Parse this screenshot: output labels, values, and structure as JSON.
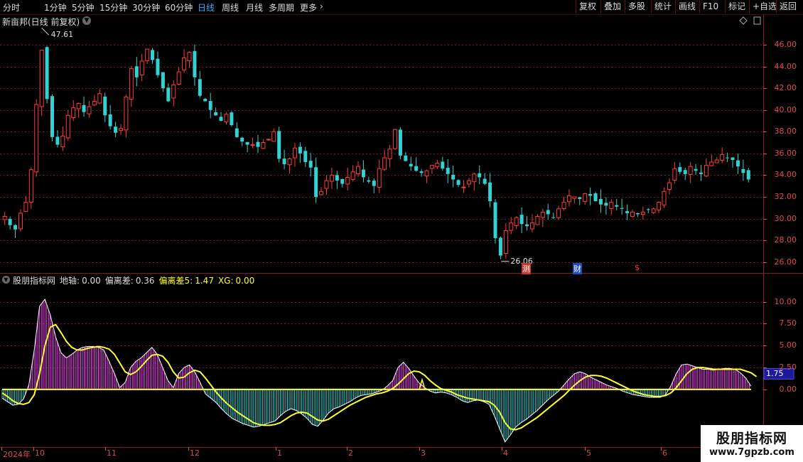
{
  "toolbar": {
    "periods": [
      {
        "label": "分时",
        "active": false
      },
      {
        "label": "1分钟",
        "active": false
      },
      {
        "label": "5分钟",
        "active": false
      },
      {
        "label": "15分钟",
        "active": false
      },
      {
        "label": "30分钟",
        "active": false
      },
      {
        "label": "60分钟",
        "active": false
      },
      {
        "label": "日线",
        "active": true
      },
      {
        "label": "周线",
        "active": false
      },
      {
        "label": "月线",
        "active": false
      },
      {
        "label": "多周期",
        "active": false
      },
      {
        "label": "更多",
        "active": false
      }
    ],
    "tools": [
      "复权",
      "叠加",
      "多股",
      "统计",
      "画线",
      "F10",
      "标记",
      "+自选",
      "返回"
    ]
  },
  "chart": {
    "stock_title": "新亩邦(日线 前复权)",
    "high_label": "47.61",
    "low_label": "26.06",
    "markers": [
      {
        "text": "测",
        "color": "#ffffff",
        "bg": "#c0392b"
      },
      {
        "text": "财",
        "color": "#ffffff",
        "bg": "#1e4db7"
      },
      {
        "text": "$",
        "color": "#ff3030",
        "bg": ""
      }
    ],
    "price_axis": [
      "46.00",
      "44.00",
      "42.00",
      "40.00",
      "38.00",
      "36.00",
      "34.00",
      "32.00",
      "30.00",
      "28.00",
      "26.00"
    ],
    "indicator_axis": [
      "10.00",
      "7.50",
      "5.00",
      "2.50",
      "0.00"
    ],
    "indicator_current_badge": "1.75",
    "months": [
      "2024年",
      "10",
      "11",
      "12",
      "1",
      "2",
      "3",
      "4",
      "5",
      "6"
    ],
    "colors": {
      "up": "#ff3b3b",
      "down": "#33d1d1",
      "yellow": "#ffff33",
      "pos_bar": "#ff40ff",
      "neg_bar": "#33d1d1",
      "axis": "#e24a4a",
      "grid": "#7a1a1a"
    }
  },
  "indicator": {
    "name": "股朋指标网",
    "items": [
      {
        "label": "地轴:",
        "value": "0.00",
        "color": "#dcdcdc"
      },
      {
        "label": "偏离差:",
        "value": "0.36",
        "color": "#dcdcdc"
      },
      {
        "label": "偏离差5:",
        "value": "1.47",
        "color": "#ffff33"
      },
      {
        "label": "XG:",
        "value": "0.00",
        "color": "#ffff33"
      }
    ]
  },
  "watermark": {
    "line1": "股朋指标网",
    "line2": "www.7gpzb.com"
  },
  "chart_data": [
    {
      "type": "candlestick",
      "title": "新亩邦(日线 前复权)",
      "ylim": [
        25,
        47.5
      ],
      "y_ticks": [
        26,
        28,
        30,
        32,
        34,
        36,
        38,
        40,
        42,
        44,
        46
      ],
      "x_labels": [
        "2024年",
        "10",
        "11",
        "12",
        "1",
        "2",
        "3",
        "4",
        "5",
        "6"
      ],
      "annotations": [
        {
          "text": "47.61",
          "type": "high"
        },
        {
          "text": "26.06",
          "type": "low"
        }
      ],
      "close_path": [
        30.2,
        29.4,
        29.0,
        30.5,
        31.5,
        34.5,
        40.5,
        45.5,
        41.0,
        37.5,
        36.8,
        37.6,
        39.5,
        40.2,
        40.6,
        39.8,
        40.3,
        40.8,
        41.5,
        39.5,
        38.5,
        37.9,
        38.3,
        41.2,
        43.8,
        43.0,
        44.5,
        45.6,
        44.6,
        43.2,
        42.0,
        40.8,
        42.3,
        43.5,
        44.8,
        45.3,
        43.0,
        41.3,
        40.8,
        40.0,
        39.5,
        39.0,
        39.6,
        38.6,
        37.5,
        37.1,
        36.8,
        36.8,
        36.6,
        37.0,
        37.3,
        38.0,
        35.5,
        35.0,
        35.5,
        36.5,
        36.0,
        35.2,
        34.7,
        32.0,
        32.5,
        33.5,
        34.0,
        33.5,
        33.2,
        33.8,
        34.3,
        34.8,
        33.8,
        33.4,
        33.0,
        34.6,
        35.6,
        36.4,
        38.2,
        35.8,
        35.3,
        34.8,
        34.4,
        34.2,
        34.4,
        34.9,
        35.1,
        34.6,
        34.1,
        33.6,
        33.1,
        32.9,
        33.5,
        34.1,
        33.8,
        33.2,
        31.6,
        28.2,
        26.6,
        28.9,
        29.6,
        30.1,
        29.5,
        29.3,
        29.6,
        30.2,
        30.6,
        30.4,
        30.1,
        30.9,
        31.5,
        32.1,
        32.0,
        31.8,
        32.3,
        32.1,
        31.6,
        31.3,
        31.2,
        31.5,
        31.1,
        30.9,
        30.5,
        30.6,
        30.4,
        30.6,
        30.8,
        30.9,
        31.5,
        32.5,
        33.3,
        34.6,
        34.3,
        34.1,
        34.8,
        34.4,
        34.1,
        34.9,
        35.2,
        35.4,
        35.9,
        35.6,
        35.4,
        34.8,
        34.2,
        33.6
      ]
    },
    {
      "type": "bar+line",
      "title": "股朋指标网",
      "ylim": [
        -6.5,
        12
      ],
      "y_ticks": [
        0,
        2.5,
        5,
        7.5,
        10
      ],
      "series": [
        {
          "name": "地轴",
          "values": [
            0.0
          ]
        },
        {
          "name": "偏离差",
          "current": 0.36,
          "path": [
            -1.0,
            -1.4,
            -1.8,
            -1.7,
            -1.1,
            0.5,
            4.5,
            9.5,
            10.3,
            8.5,
            6.0,
            4.2,
            3.6,
            4.0,
            4.5,
            4.8,
            4.9,
            4.9,
            4.8,
            4.5,
            3.2,
            1.8,
            0.2,
            0.8,
            2.5,
            3.2,
            3.6,
            4.2,
            4.8,
            4.0,
            2.5,
            1.0,
            0.2,
            1.8,
            2.5,
            2.8,
            2.0,
            0.8,
            -0.5,
            -1.0,
            -1.5,
            -2.2,
            -2.8,
            -3.3,
            -3.6,
            -3.9,
            -4.1,
            -4.3,
            -4.2,
            -4.0,
            -3.8,
            -3.6,
            -3.0,
            -2.5,
            -2.2,
            -2.4,
            -2.8,
            -3.3,
            -4.0,
            -4.2,
            -3.5,
            -2.7,
            -2.2,
            -2.0,
            -1.7,
            -1.4,
            -1.0,
            -0.7,
            -0.6,
            -0.5,
            -0.3,
            -0.1,
            0.4,
            1.0,
            2.5,
            3.1,
            2.4,
            1.5,
            0.7,
            0.2,
            -0.2,
            -0.4,
            -0.3,
            -0.4,
            -0.6,
            -0.9,
            -1.3,
            -1.5,
            -1.3,
            -1.2,
            -1.4,
            -1.7,
            -3.0,
            -4.5,
            -6.0,
            -5.2,
            -4.3,
            -3.8,
            -3.4,
            -2.9,
            -2.4,
            -1.8,
            -1.2,
            -0.7,
            -0.2,
            0.5,
            1.2,
            1.8,
            2.0,
            1.8,
            1.4,
            1.1,
            0.8,
            0.5,
            0.3,
            0.1,
            -0.2,
            -0.4,
            -0.6,
            -0.7,
            -0.8,
            -0.9,
            -0.9,
            -0.9,
            -0.6,
            0.4,
            1.8,
            2.8,
            2.9,
            2.7,
            2.5,
            2.3,
            2.3,
            2.2,
            2.3,
            2.4,
            2.4,
            2.3,
            1.9,
            1.3,
            0.36
          ]
        },
        {
          "name": "偏离差5",
          "current": 1.47,
          "path": [
            -0.4,
            -0.8,
            -1.3,
            -1.6,
            -1.7,
            -1.5,
            -0.6,
            1.8,
            5.0,
            7.1,
            7.4,
            6.5,
            5.5,
            4.8,
            4.5,
            4.5,
            4.7,
            4.8,
            4.9,
            4.8,
            4.6,
            4.0,
            3.0,
            2.0,
            1.7,
            2.0,
            2.6,
            3.3,
            3.9,
            4.0,
            3.8,
            3.1,
            2.0,
            1.3,
            1.4,
            1.9,
            2.2,
            2.0,
            1.3,
            0.5,
            -0.3,
            -1.0,
            -1.6,
            -2.1,
            -2.6,
            -3.0,
            -3.4,
            -3.8,
            -4.0,
            -4.1,
            -4.1,
            -4.0,
            -3.8,
            -3.4,
            -3.0,
            -2.7,
            -2.6,
            -2.7,
            -3.1,
            -3.5,
            -3.6,
            -3.4,
            -3.0,
            -2.6,
            -2.2,
            -1.8,
            -1.5,
            -1.2,
            -0.9,
            -0.7,
            -0.5,
            -0.4,
            -0.2,
            0.1,
            0.6,
            1.2,
            1.8,
            2.1,
            2.0,
            1.6,
            1.0,
            0.5,
            0.1,
            -0.1,
            -0.3,
            -0.6,
            -0.8,
            -1.0,
            -1.1,
            -1.2,
            -1.3,
            -1.4,
            -1.8,
            -2.6,
            -3.8,
            -4.5,
            -4.6,
            -4.4,
            -4.0,
            -3.6,
            -3.2,
            -2.7,
            -2.2,
            -1.7,
            -1.2,
            -0.7,
            -0.1,
            0.5,
            1.0,
            1.4,
            1.6,
            1.6,
            1.5,
            1.3,
            1.0,
            0.7,
            0.4,
            0.1,
            -0.2,
            -0.4,
            -0.6,
            -0.7,
            -0.8,
            -0.8,
            -0.7,
            -0.4,
            0.2,
            1.0,
            1.8,
            2.3,
            2.5,
            2.5,
            2.4,
            2.3,
            2.3,
            2.3,
            2.3,
            2.3,
            2.3,
            2.1,
            1.9,
            1.47
          ]
        },
        {
          "name": "XG",
          "values": [
            0.0
          ]
        }
      ]
    }
  ]
}
